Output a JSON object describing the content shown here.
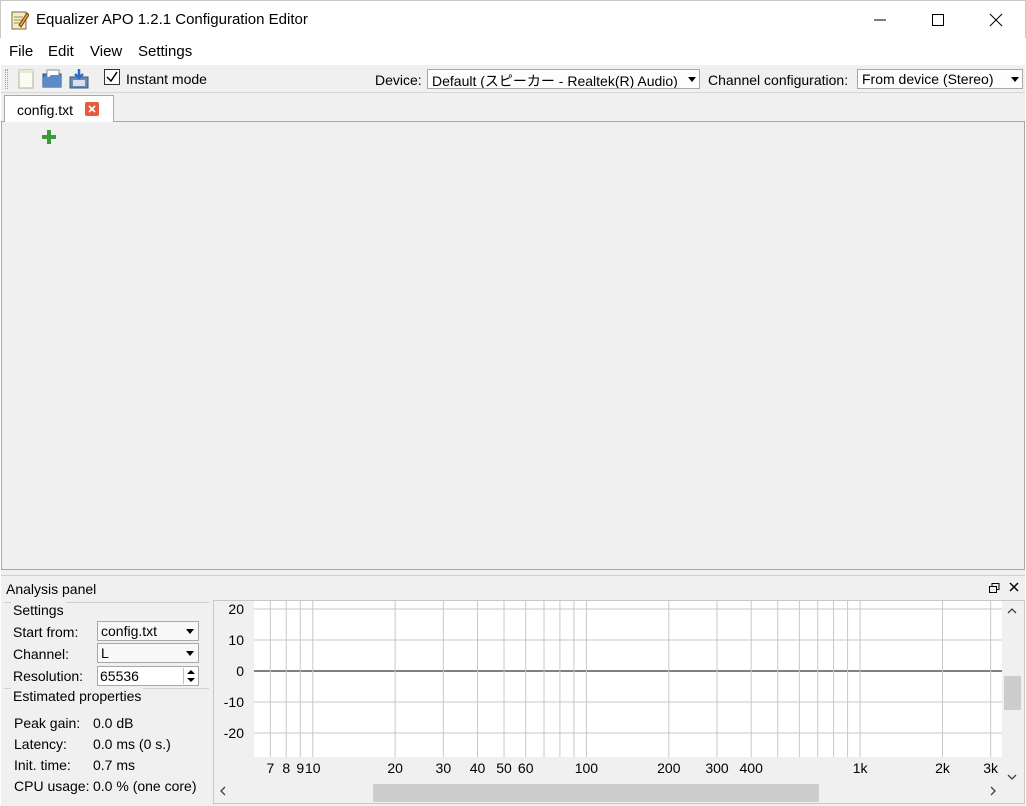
{
  "window": {
    "title": "Equalizer APO 1.2.1 Configuration Editor",
    "icon": "notepad-pencil-icon"
  },
  "menu": [
    "File",
    "Edit",
    "View",
    "Settings"
  ],
  "toolbar": {
    "instant_mode_label": "Instant mode",
    "instant_mode_checked": true,
    "device_label": "Device:",
    "device_value": "Default (スピーカー - Realtek(R) Audio)",
    "channel_config_label": "Channel configuration:",
    "channel_config_value": "From device (Stereo)"
  },
  "tabs": [
    {
      "label": "config.txt"
    }
  ],
  "analysis_panel": {
    "title": "Analysis panel",
    "settings": {
      "title": "Settings",
      "start_from_label": "Start from:",
      "start_from_value": "config.txt",
      "channel_label": "Channel:",
      "channel_value": "L",
      "resolution_label": "Resolution:",
      "resolution_value": "65536"
    },
    "estimated": {
      "title": "Estimated properties",
      "rows": [
        {
          "label": "Peak gain:",
          "value": "0.0 dB"
        },
        {
          "label": "Latency:",
          "value": "0.0 ms (0 s.)"
        },
        {
          "label": "Init. time:",
          "value": "0.7 ms"
        },
        {
          "label": "CPU usage:",
          "value": "0.0 % (one core)"
        }
      ]
    },
    "graph": {
      "y_ticks": [
        "20",
        "10",
        "0",
        "-10",
        "-20"
      ],
      "x_ticks": [
        "7",
        "8",
        "9",
        "10",
        "20",
        "30",
        "40",
        "50",
        "60",
        "100",
        "200",
        "300",
        "400",
        "1k",
        "2k",
        "3k"
      ]
    }
  },
  "colors": {
    "panel_bg": "#f0f0f0",
    "close_badge": "#e85a3a",
    "add_green": "#3c9a3c",
    "plot_bg": "#ffffff",
    "gridline": "#c8c8c8"
  }
}
